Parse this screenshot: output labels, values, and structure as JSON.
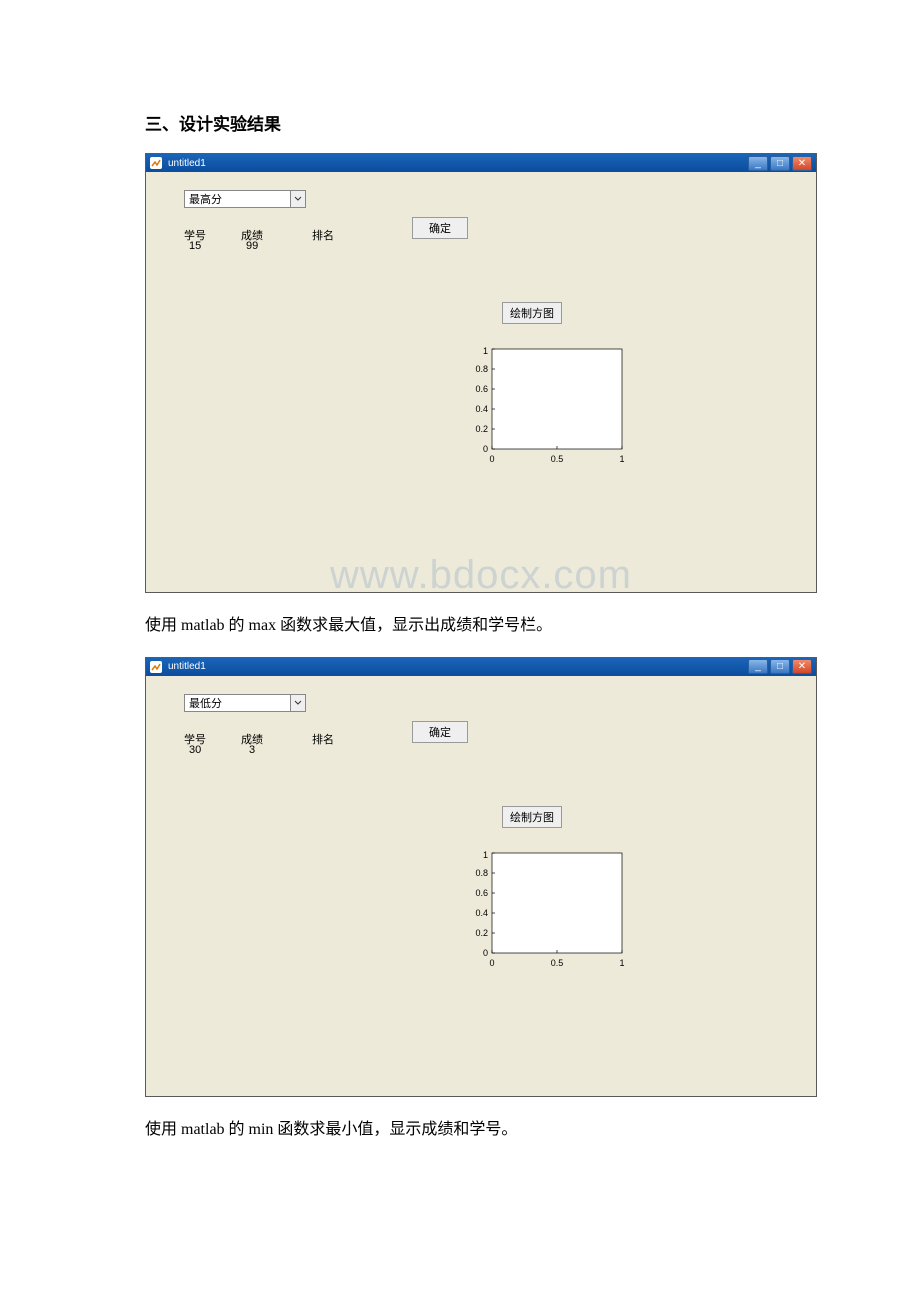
{
  "section_title": "三、设计实验结果",
  "watermark_text": "www.bdocx.com",
  "window1": {
    "title": "untitled1",
    "dropdown_value": "最高分",
    "labels": {
      "id": "学号",
      "score": "成绩",
      "rank": "排名"
    },
    "values": {
      "id": "15",
      "score": "99"
    },
    "buttons": {
      "ok": "确定",
      "plot": "绘制方图"
    }
  },
  "caption1": "使用 matlab 的 max 函数求最大值，显示出成绩和学号栏。",
  "window2": {
    "title": "untitled1",
    "dropdown_value": "最低分",
    "labels": {
      "id": "学号",
      "score": "成绩",
      "rank": "排名"
    },
    "values": {
      "id": "30",
      "score": "3"
    },
    "buttons": {
      "ok": "确定",
      "plot": "绘制方图"
    }
  },
  "caption2": "使用 matlab 的 min 函数求最小值，显示成绩和学号。",
  "chart_data": [
    {
      "type": "line",
      "title": "",
      "xlabel": "",
      "ylabel": "",
      "xlim": [
        0,
        1
      ],
      "ylim": [
        0,
        1
      ],
      "xticks": [
        0,
        0.5,
        1
      ],
      "yticks": [
        0,
        0.2,
        0.4,
        0.6,
        0.8,
        1
      ],
      "series": []
    },
    {
      "type": "line",
      "title": "",
      "xlabel": "",
      "ylabel": "",
      "xlim": [
        0,
        1
      ],
      "ylim": [
        0,
        1
      ],
      "xticks": [
        0,
        0.5,
        1
      ],
      "yticks": [
        0,
        0.2,
        0.4,
        0.6,
        0.8,
        1
      ],
      "series": []
    }
  ]
}
